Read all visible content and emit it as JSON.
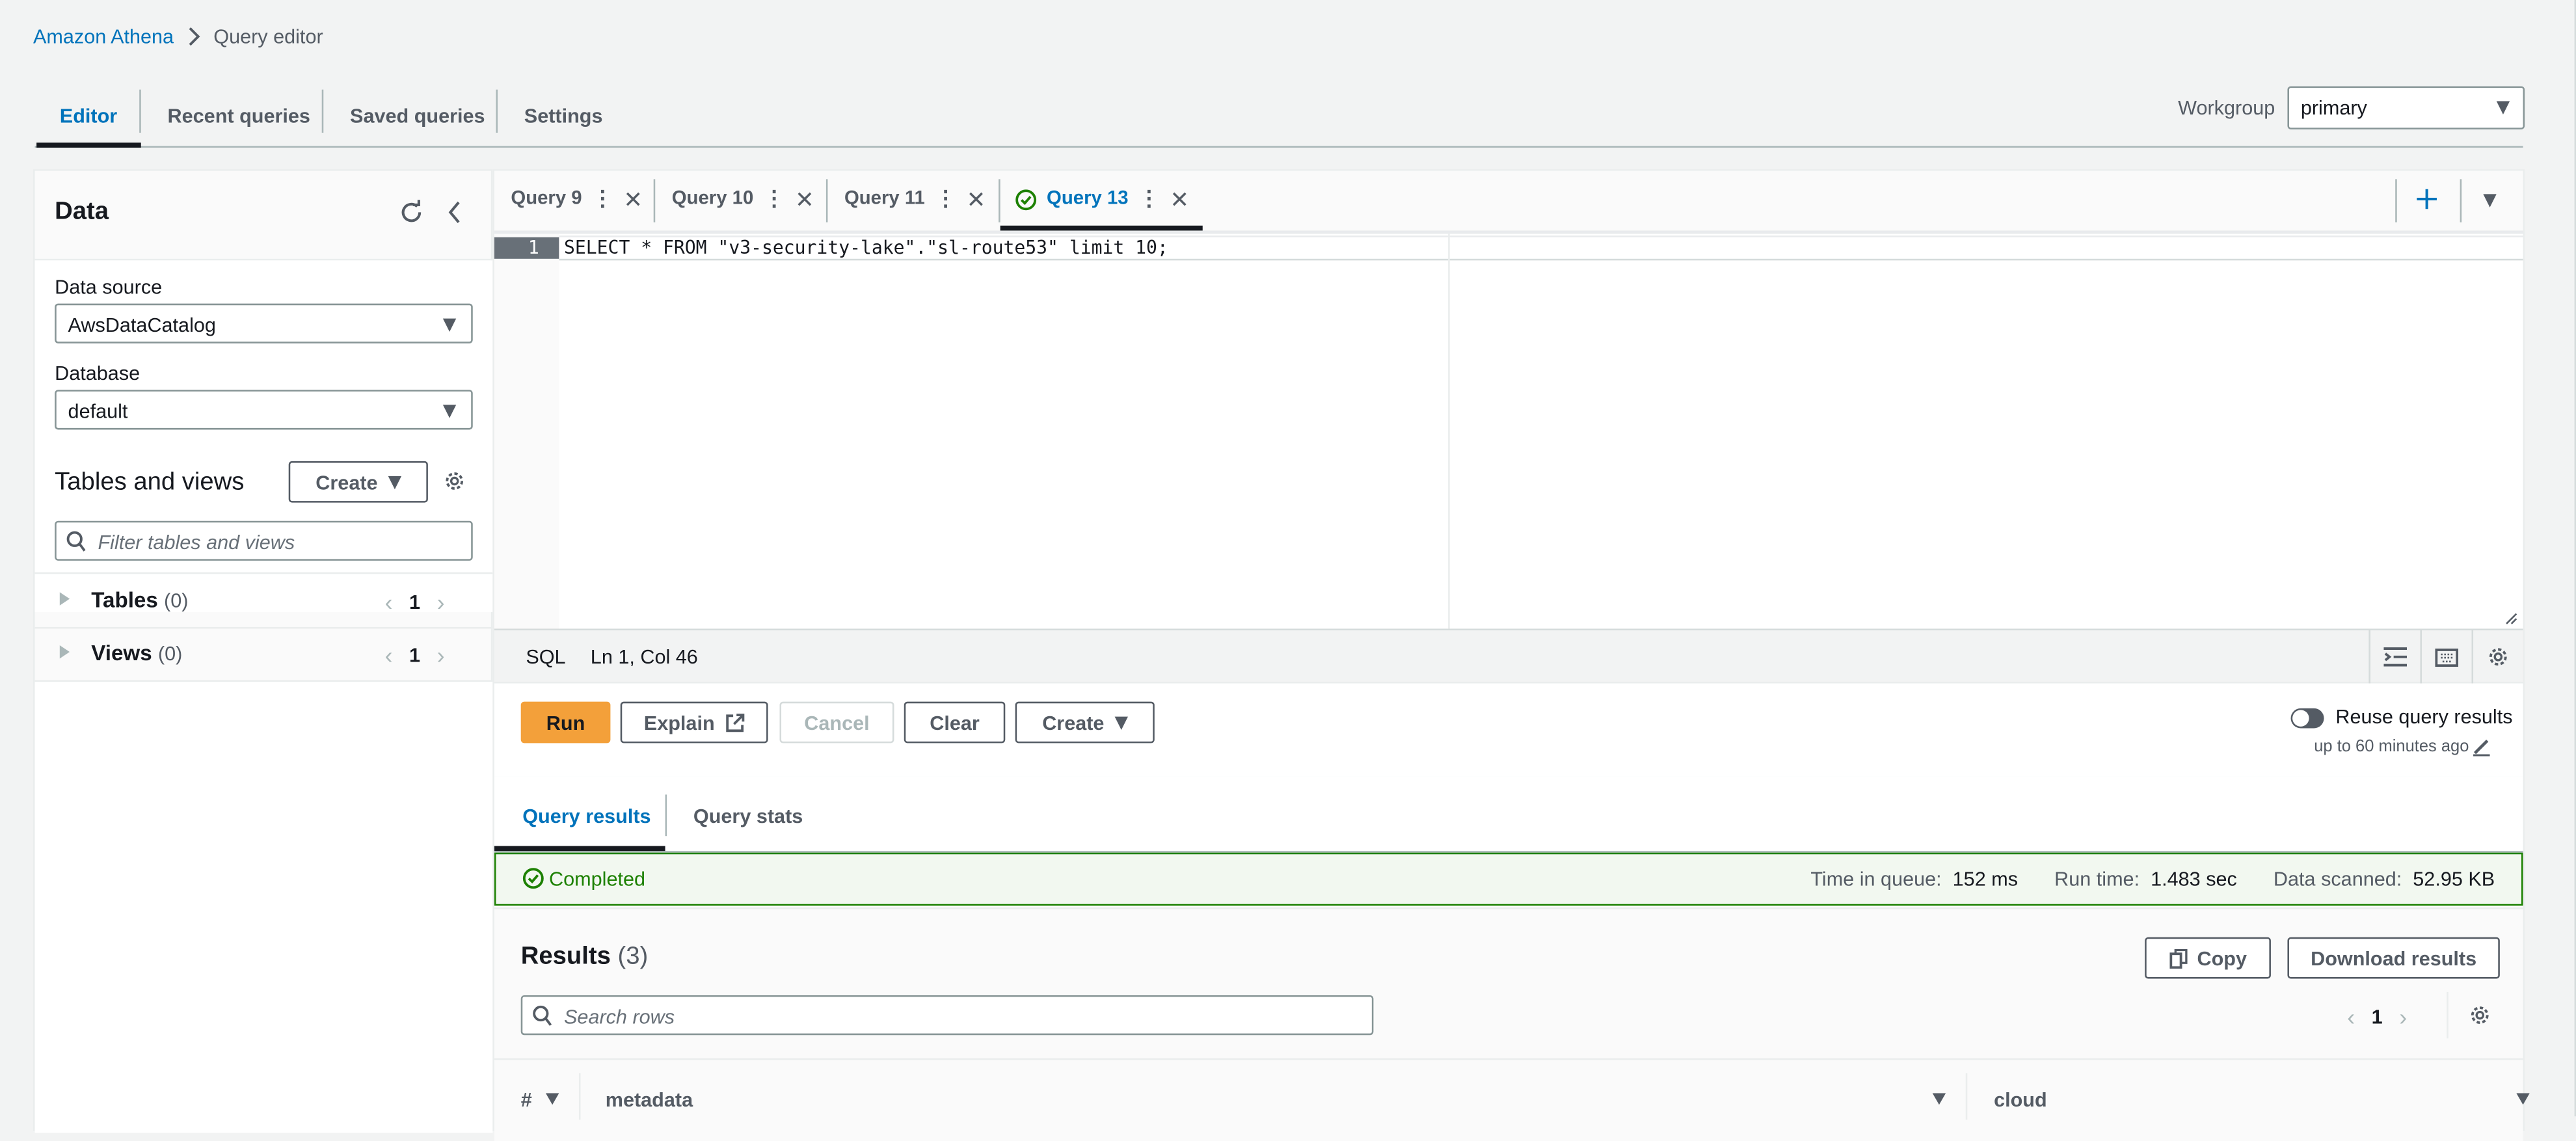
{
  "breadcrumb": {
    "root": "Amazon Athena",
    "current": "Query editor"
  },
  "top_tabs": [
    {
      "label": "Editor",
      "active": true
    },
    {
      "label": "Recent queries",
      "active": false
    },
    {
      "label": "Saved queries",
      "active": false
    },
    {
      "label": "Settings",
      "active": false
    }
  ],
  "workgroup": {
    "label": "Workgroup",
    "value": "primary"
  },
  "data_panel": {
    "title": "Data",
    "data_source_label": "Data source",
    "data_source_value": "AwsDataCatalog",
    "database_label": "Database",
    "database_value": "default",
    "tables_views_title": "Tables and views",
    "create_label": "Create",
    "filter_placeholder": "Filter tables and views",
    "tables": {
      "label": "Tables",
      "count": "(0)",
      "page": "1"
    },
    "views": {
      "label": "Views",
      "count": "(0)",
      "page": "1"
    }
  },
  "query_tabs": [
    {
      "label": "Query 9",
      "active": false,
      "status": ""
    },
    {
      "label": "Query 10",
      "active": false,
      "status": ""
    },
    {
      "label": "Query 11",
      "active": false,
      "status": ""
    },
    {
      "label": "Query 13",
      "active": true,
      "status": "success"
    }
  ],
  "editor": {
    "line_number": "1",
    "code": "SELECT * FROM \"v3-security-lake\".\"sl-route53\" limit 10;",
    "language": "SQL",
    "cursor": "Ln 1, Col 46"
  },
  "actions": {
    "run": "Run",
    "explain": "Explain",
    "cancel": "Cancel",
    "clear": "Clear",
    "create": "Create",
    "reuse_label": "Reuse query results",
    "reuse_enabled": false,
    "reuse_window": "up to 60 minutes ago"
  },
  "result_tabs": [
    {
      "label": "Query results",
      "active": true
    },
    {
      "label": "Query stats",
      "active": false
    }
  ],
  "status": {
    "text": "Completed",
    "time_in_queue_label": "Time in queue:",
    "time_in_queue": "152 ms",
    "run_time_label": "Run time:",
    "run_time": "1.483 sec",
    "data_scanned_label": "Data scanned:",
    "data_scanned": "52.95 KB"
  },
  "results": {
    "title": "Results",
    "count": "(3)",
    "copy": "Copy",
    "download": "Download results",
    "search_placeholder": "Search rows",
    "page": "1",
    "columns": [
      "#",
      "metadata",
      "cloud"
    ]
  },
  "colors": {
    "link": "#0073bb",
    "primary_button": "#f3a03a",
    "success": "#1d8102"
  }
}
